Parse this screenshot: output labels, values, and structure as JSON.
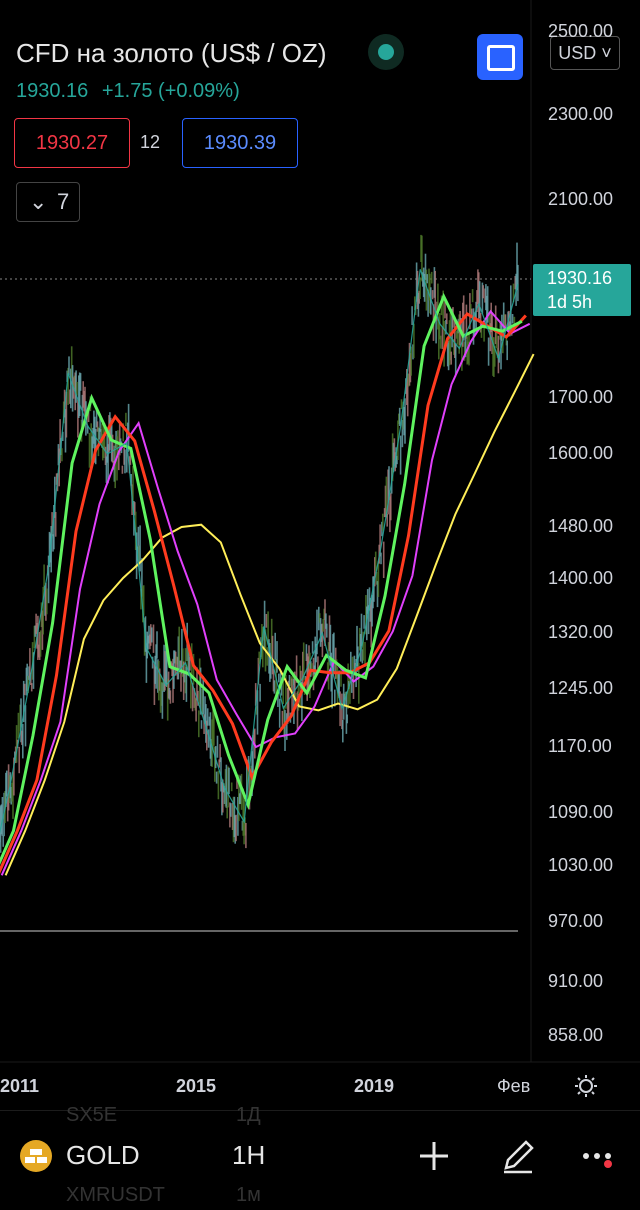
{
  "header": {
    "title": "CFD на золото (US$ / OZ)",
    "price": "1930.16",
    "change": "+1.75",
    "change_pct": "(+0.09%)",
    "bid": "1930.27",
    "spread": "12",
    "ask": "1930.39",
    "indicator_count": "7",
    "currency": "USD"
  },
  "price_axis": {
    "labels": [
      "2500.00",
      "2300.00",
      "2100.00",
      "1700.00",
      "1600.00",
      "1480.00",
      "1400.00",
      "1320.00",
      "1245.00",
      "1170.00",
      "1090.00",
      "1030.00",
      "970.00",
      "910.00",
      "858.00"
    ]
  },
  "current_price_label": {
    "price": "1930.16",
    "time_left": "1d 5h"
  },
  "time_axis": {
    "labels": [
      "2011",
      "2015",
      "2019",
      "Фев"
    ]
  },
  "bottom_bar": {
    "symbol": "GOLD",
    "interval": "1H",
    "ghost_rows": [
      {
        "symbol": "SX5E",
        "interval": "1Д"
      },
      {
        "symbol": "XMRUSDT",
        "interval": "1м"
      }
    ]
  },
  "colors": {
    "up": "#26a69a",
    "down": "#f23645",
    "accent": "#2962ff",
    "ma_fast": "#5ff35f",
    "ma_red": "#ff3b1f",
    "ma_magenta": "#e040fb",
    "ma_yellow": "#ffee58"
  },
  "chart_data": {
    "type": "line",
    "x": [
      "2009.5",
      "2010",
      "2010.5",
      "2011",
      "2011.5",
      "2012",
      "2012.5",
      "2013",
      "2013.5",
      "2014",
      "2014.5",
      "2015",
      "2015.5",
      "2016",
      "2016.5",
      "2017",
      "2017.5",
      "2018",
      "2018.5",
      "2019",
      "2019.5",
      "2020",
      "2020.5",
      "2021",
      "2021.5",
      "2022",
      "2022.5",
      "2023"
    ],
    "series": [
      {
        "values": [
          1020,
          1120,
          1250,
          1420,
          1750,
          1650,
          1600,
          1620,
          1300,
          1250,
          1280,
          1200,
          1120,
          1080,
          1330,
          1220,
          1260,
          1320,
          1220,
          1300,
          1450,
          1650,
          1960,
          1850,
          1800,
          1890,
          1780,
          1930
        ]
      }
    ],
    "ylim": [
      858,
      2500
    ],
    "grid": false
  }
}
